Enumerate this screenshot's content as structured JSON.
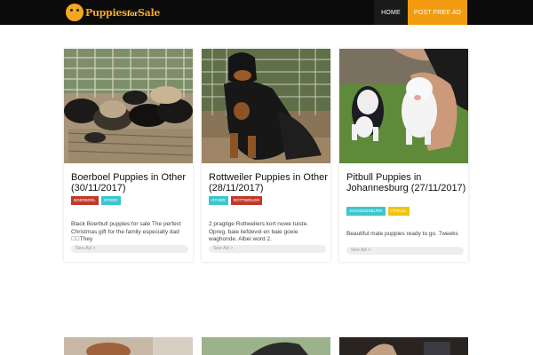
{
  "header": {
    "logo_main": "Puppies",
    "logo_small": "for",
    "logo_end": "Sale",
    "nav": [
      {
        "label": "HOME"
      },
      {
        "label": "POST FREE AD"
      }
    ]
  },
  "listings": [
    {
      "title": "Boerboel Puppies in Other (30/11/2017)",
      "tags": [
        "BOERBOEL",
        "OTHER"
      ],
      "excerpt": "Black Boerbull puppies for sale The perfect Christmas gift for the family especially dad \u0000\u0000They",
      "cta": "See Ad >"
    },
    {
      "title": "Rottweiler Puppies in Other (28/11/2017)",
      "tags": [
        "OTHER",
        "ROTTWEILER"
      ],
      "excerpt": "2 pragtige Rottweilers kort nuwe tuiste. Opreg, baie liefdevol en baie goeie waghonde. Albei word 2.",
      "cta": "See Ad >"
    },
    {
      "title": "Pitbull Puppies in Johannesburg (27/11/2017)",
      "tags": [
        "JOHANNESBURG",
        "PITBULL"
      ],
      "excerpt": "Beautiful male puppies ready to go. 7weeks",
      "cta": "See Ad >"
    }
  ],
  "colors": {
    "header_bg": "#0b0b0b",
    "accent_orange": "#f39c12",
    "tag_red": "#c0392b",
    "tag_cyan": "#3cc6cf",
    "tag_yellow": "#f1c40f"
  }
}
